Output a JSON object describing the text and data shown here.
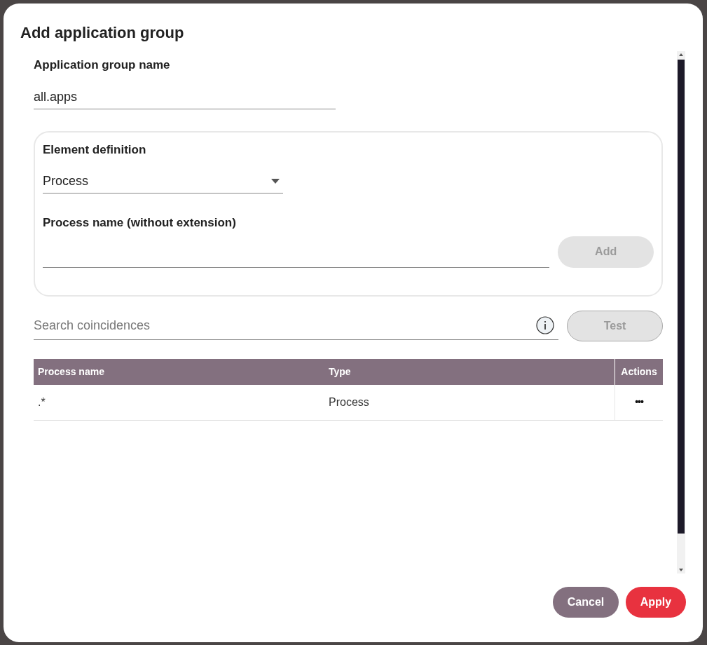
{
  "dialog": {
    "title": "Add application group"
  },
  "group_name": {
    "label": "Application group name",
    "value": "all.apps"
  },
  "element_definition": {
    "title": "Element definition",
    "type_select": {
      "value": "Process"
    },
    "process_name": {
      "label": "Process name (without extension)"
    },
    "add_button": {
      "label": "Add",
      "disabled": true
    }
  },
  "search": {
    "placeholder": "Search coincidences",
    "test_button": {
      "label": "Test",
      "disabled": true
    }
  },
  "table": {
    "columns": [
      "Process name",
      "Type",
      "Actions"
    ],
    "rows": [
      {
        "process_name": ".*",
        "type": "Process",
        "actions": "•••"
      }
    ]
  },
  "buttons": [
    {
      "label": "Cancel",
      "kind": "secondary"
    },
    {
      "label": "Apply",
      "kind": "primary"
    }
  ]
}
